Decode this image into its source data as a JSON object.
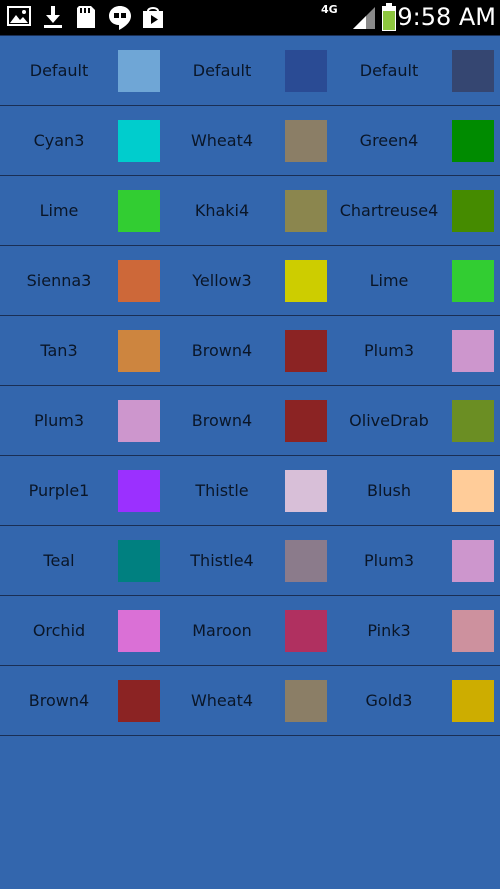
{
  "status_bar": {
    "time": "9:58 AM",
    "network": "4G",
    "icons": [
      "gallery-icon",
      "download-icon",
      "sd-card-icon",
      "hangouts-icon",
      "play-store-icon",
      "signal-icon",
      "battery-icon"
    ]
  },
  "rows": [
    [
      {
        "label": "Default",
        "color": "#6fa6d6"
      },
      {
        "label": "Default",
        "color": "#2a4b94"
      },
      {
        "label": "Default",
        "color": "#354671"
      }
    ],
    [
      {
        "label": "Cyan3",
        "color": "#00cdcd"
      },
      {
        "label": "Wheat4",
        "color": "#8b7e66"
      },
      {
        "label": "Green4",
        "color": "#008b00"
      }
    ],
    [
      {
        "label": "Lime",
        "color": "#32cd32"
      },
      {
        "label": "Khaki4",
        "color": "#8b864e"
      },
      {
        "label": "Chartreuse4",
        "color": "#458b00"
      }
    ],
    [
      {
        "label": "Sienna3",
        "color": "#cd6839"
      },
      {
        "label": "Yellow3",
        "color": "#cdcd00"
      },
      {
        "label": "Lime",
        "color": "#32cd32"
      }
    ],
    [
      {
        "label": "Tan3",
        "color": "#cd853f"
      },
      {
        "label": "Brown4",
        "color": "#8b2323"
      },
      {
        "label": "Plum3",
        "color": "#cd96cd"
      }
    ],
    [
      {
        "label": "Plum3",
        "color": "#cd96cd"
      },
      {
        "label": "Brown4",
        "color": "#8b2323"
      },
      {
        "label": "OliveDrab",
        "color": "#6b8e23"
      }
    ],
    [
      {
        "label": "Purple1",
        "color": "#9b30ff"
      },
      {
        "label": "Thistle",
        "color": "#d8bfd8"
      },
      {
        "label": "Blush",
        "color": "#ffcc99"
      }
    ],
    [
      {
        "label": "Teal",
        "color": "#008080"
      },
      {
        "label": "Thistle4",
        "color": "#8b7b8b"
      },
      {
        "label": "Plum3",
        "color": "#cd96cd"
      }
    ],
    [
      {
        "label": "Orchid",
        "color": "#da70d6"
      },
      {
        "label": "Maroon",
        "color": "#b03060"
      },
      {
        "label": "Pink3",
        "color": "#cd919e"
      }
    ],
    [
      {
        "label": "Brown4",
        "color": "#8b2323"
      },
      {
        "label": "Wheat4",
        "color": "#8b7e66"
      },
      {
        "label": "Gold3",
        "color": "#cdad00"
      }
    ]
  ]
}
